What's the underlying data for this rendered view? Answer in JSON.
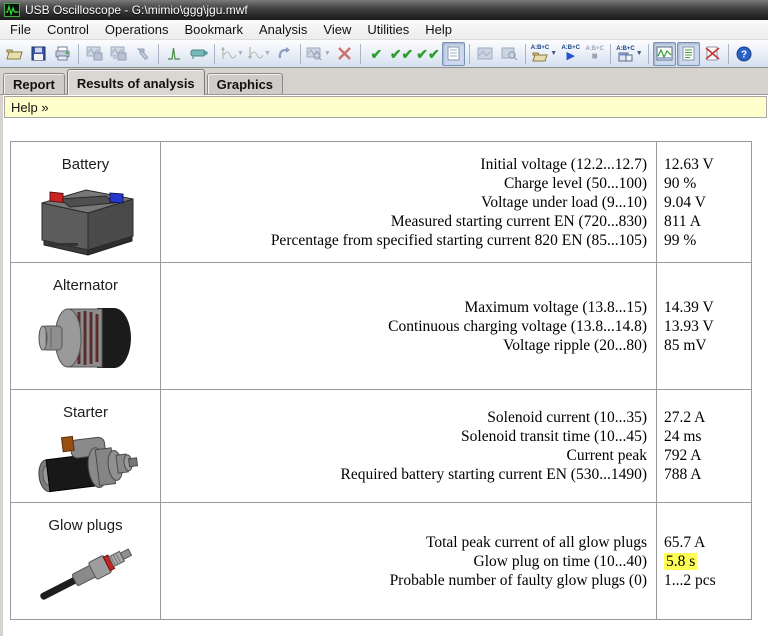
{
  "title_bar": {
    "title": "USB Oscilloscope - G:\\mimio\\ggg\\jgu.mwf"
  },
  "menu_bar": {
    "items": [
      "File",
      "Control",
      "Operations",
      "Bookmark",
      "Analysis",
      "View",
      "Utilities",
      "Help"
    ]
  },
  "toolbar": {
    "abc_label": "A:B+C",
    "button_names": [
      "open-file",
      "save-file",
      "print",
      "save-waveform",
      "save-waveform-as",
      "tools",
      "impulse-signal",
      "clamp-signal",
      "signal-next",
      "signal-prev",
      "undo",
      "chart-zoom",
      "delete-chart",
      "accept-check",
      "accept-all-check",
      "apply-check",
      "report-toggle",
      "chart-view-disabled",
      "chart-find-disabled",
      "abc-open",
      "abc-run",
      "abc-stop",
      "abc-window",
      "graphics-view",
      "report-view",
      "delete-report",
      "help"
    ]
  },
  "tab_bar": {
    "tabs": [
      {
        "label": "Report",
        "active": false
      },
      {
        "label": "Results of analysis",
        "active": true
      },
      {
        "label": "Graphics",
        "active": false
      }
    ]
  },
  "help_bar": {
    "label": "Help »"
  },
  "results_table": {
    "rows": [
      {
        "component": "Battery",
        "image": "battery-image",
        "params": [
          {
            "name": "Initial voltage (12.2...12.7)",
            "value": "12.63 V"
          },
          {
            "name": "Charge level (50...100)",
            "value": "90 %"
          },
          {
            "name": "Voltage under load (9...10)",
            "value": "9.04 V"
          },
          {
            "name": "Measured starting current EN (720...830)",
            "value": "811 A"
          },
          {
            "name": "Percentage from specified starting current 820 EN (85...105)",
            "value": "99 %"
          }
        ]
      },
      {
        "component": "Alternator",
        "image": "alternator-image",
        "params": [
          {
            "name": "Maximum voltage (13.8...15)",
            "value": "14.39 V"
          },
          {
            "name": "Continuous charging voltage (13.8...14.8)",
            "value": "13.93 V"
          },
          {
            "name": "Voltage ripple (20...80)",
            "value": "85 mV"
          }
        ]
      },
      {
        "component": "Starter",
        "image": "starter-image",
        "params": [
          {
            "name": "Solenoid current (10...35)",
            "value": "27.2 A"
          },
          {
            "name": "Solenoid transit time (10...45)",
            "value": "24 ms"
          },
          {
            "name": "Current peak",
            "value": "792 A"
          },
          {
            "name": "Required battery starting current EN (530...1490)",
            "value": "788 A"
          }
        ]
      },
      {
        "component": "Glow plugs",
        "image": "glow-plug-image",
        "params": [
          {
            "name": "Total peak current of all glow plugs",
            "value": "65.7 A"
          },
          {
            "name": "Glow plug on time (10...40)",
            "value": "5.8 s",
            "highlight": true
          },
          {
            "name": "Probable number of faulty glow plugs (0)",
            "value": "1...2 pcs"
          }
        ]
      }
    ]
  },
  "colors": {
    "highlight": "#ffff55",
    "help_bar_bg": "#ffffcb",
    "title_bar_dark": "#262626",
    "toolbar_bg": "#e8eef7",
    "tab_bg": "#d6d3ce",
    "table_border": "#9a9a9a"
  }
}
